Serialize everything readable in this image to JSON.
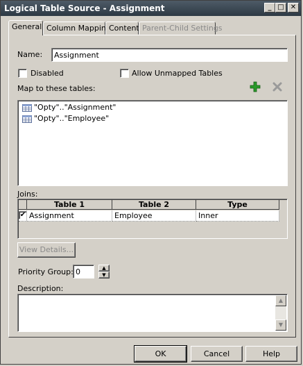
{
  "window": {
    "title": "Logical Table Source - Assignment",
    "minimize_glyph": "_",
    "maximize_glyph": "□",
    "close_glyph": "✕"
  },
  "tabs": [
    {
      "label": "General",
      "active": true
    },
    {
      "label": "Column Mapping",
      "active": false
    },
    {
      "label": "Content",
      "active": false
    },
    {
      "label": "Parent-Child Settings",
      "active": false,
      "disabled": true
    }
  ],
  "general": {
    "name_label": "Name:",
    "name_value": "Assignment",
    "disabled_label": "Disabled",
    "disabled_checked": false,
    "allow_unmapped_label": "Allow Unmapped Tables",
    "allow_unmapped_checked": false,
    "map_label": "Map to these tables:",
    "mapped_tables": [
      "\"Opty\"..\"Assignment\"",
      "\"Opty\"..\"Employee\""
    ],
    "joins_label": "Joins:",
    "joins_columns": [
      "Table 1",
      "Table 2",
      "Type"
    ],
    "joins_rows": [
      {
        "checked": true,
        "table1": "Assignment",
        "table2": "Employee",
        "type": "Inner"
      }
    ],
    "view_details_label": "View Details...",
    "priority_group_label": "Priority Group:",
    "priority_group_value": "0",
    "description_label": "Description:",
    "description_value": ""
  },
  "buttons": {
    "ok": "OK",
    "cancel": "Cancel",
    "help": "Help"
  },
  "icons": {
    "add": "plus-icon",
    "remove": "x-icon",
    "table": "table-icon"
  },
  "colors": {
    "titlebar": "#3b4853",
    "add_icon": "#2a9a2a",
    "face": "#d4d0c8"
  }
}
